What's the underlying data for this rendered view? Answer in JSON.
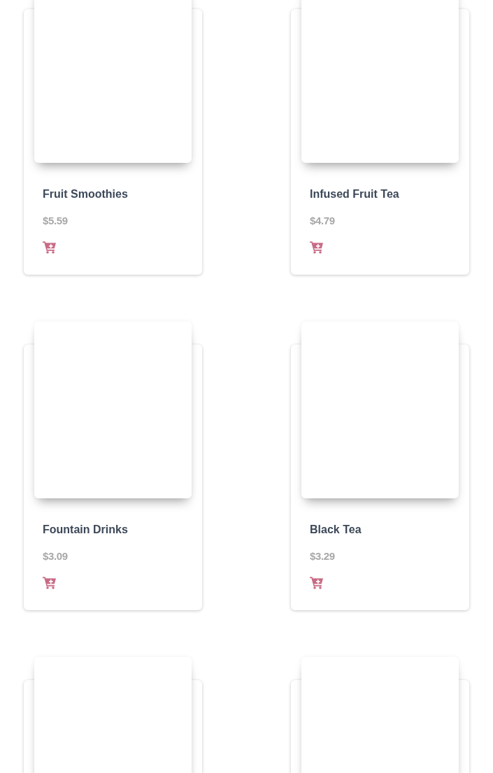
{
  "products": [
    {
      "kind": "product",
      "name": "Fruit Smoothies",
      "price": "$5.59"
    },
    {
      "kind": "product",
      "name": "Infused Fruit Tea",
      "price": "$4.79"
    },
    {
      "kind": "product",
      "name": "Fountain Drinks",
      "price": "$3.09"
    },
    {
      "kind": "product",
      "name": "Black Tea",
      "price": "$3.29"
    },
    {
      "kind": "loading"
    },
    {
      "kind": "loading"
    }
  ]
}
